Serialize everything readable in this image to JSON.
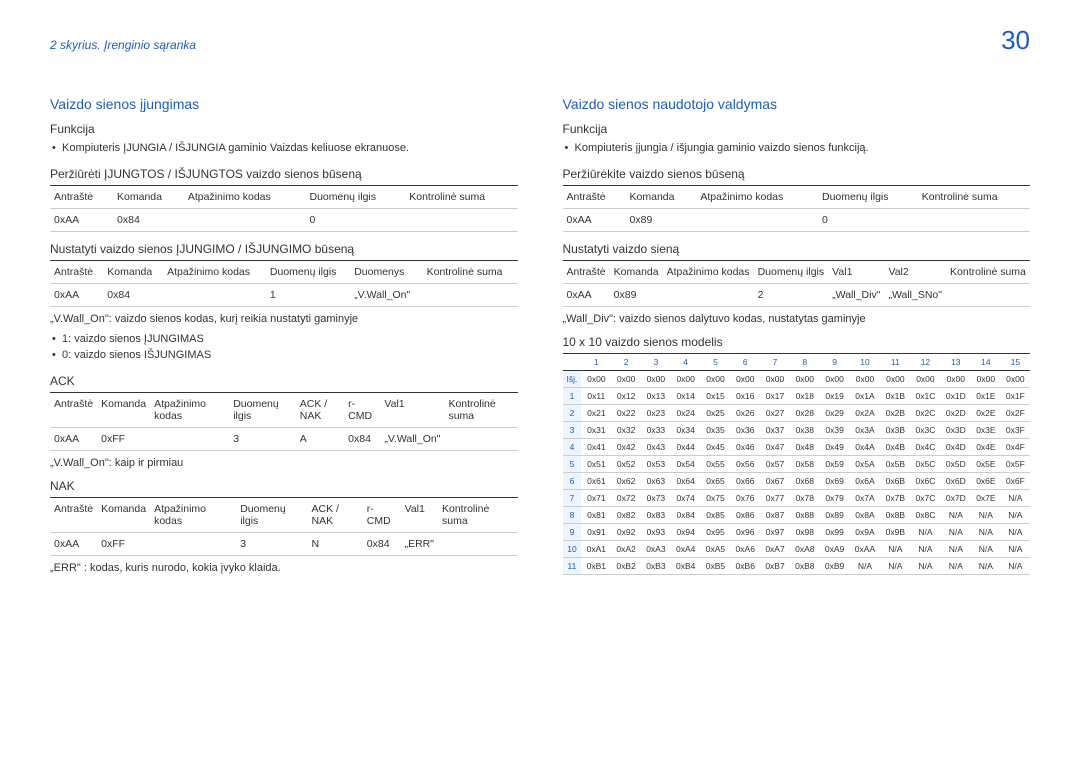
{
  "header": {
    "chapter": "2 skyrius. Įrenginio sąranka",
    "page": "30"
  },
  "left": {
    "title": "Vaizdo sienos įjungimas",
    "func_h": "Funkcija",
    "func_b_pre": "Kompiuteris ĮJUNGIA / IŠJUNGIA gaminio ",
    "func_b_hl": "Vaizdas keliuose ekranuose",
    "func_b_post": ".",
    "view_h": "Peržiūrėti ĮJUNGTOS / IŠJUNGTOS vaizdo sienos būseną",
    "view_th": [
      "Antraštė",
      "Komanda",
      "Atpažinimo kodas",
      "Duomenų ilgis",
      "Kontrolinė suma"
    ],
    "view_td": [
      "0xAA",
      "0x84",
      "",
      "0",
      ""
    ],
    "set_h": "Nustatyti vaizdo sienos ĮJUNGIMO / IŠJUNGIMO būseną",
    "set_th": [
      "Antraštė",
      "Komanda",
      "Atpažinimo kodas",
      "Duomenų ilgis",
      "Duomenys",
      "Kontrolinė suma"
    ],
    "set_td": [
      "0xAA",
      "0x84",
      "",
      "1",
      "„V.Wall_On\"",
      ""
    ],
    "note1": "„V.Wall_On\": vaizdo sienos kodas, kurį reikia nustatyti gaminyje",
    "bul1": "1: vaizdo sienos ĮJUNGIMAS",
    "bul2": "0: vaizdo sienos IŠJUNGIMAS",
    "ack_h": "ACK",
    "ack_th": [
      "Antraštė",
      "Komanda",
      "Atpažinimo kodas",
      "Duomenų ilgis",
      "ACK / NAK",
      "r-CMD",
      "Val1",
      "Kontrolinė suma"
    ],
    "ack_td": [
      "0xAA",
      "0xFF",
      "",
      "3",
      "A",
      "0x84",
      "„V.Wall_On\"",
      ""
    ],
    "note2": "„V.Wall_On\": kaip ir pirmiau",
    "nak_h": "NAK",
    "nak_th": [
      "Antraštė",
      "Komanda",
      "Atpažinimo kodas",
      "Duomenų ilgis",
      "ACK / NAK",
      "r-CMD",
      "Val1",
      "Kontrolinė suma"
    ],
    "nak_td": [
      "0xAA",
      "0xFF",
      "",
      "3",
      "N",
      "0x84",
      "„ERR\"",
      ""
    ],
    "note3": "„ERR\" : kodas, kuris nurodo, kokia įvyko klaida."
  },
  "right": {
    "title": "Vaizdo sienos naudotojo valdymas",
    "func_h": "Funkcija",
    "func_b": "Kompiuteris įjungia / išjungia gaminio vaizdo sienos funkciją.",
    "view_h": "Peržiūrėkite vaizdo sienos būseną",
    "view_th": [
      "Antraštė",
      "Komanda",
      "Atpažinimo kodas",
      "Duomenų ilgis",
      "Kontrolinė suma"
    ],
    "view_td": [
      "0xAA",
      "0x89",
      "",
      "0",
      ""
    ],
    "set_h": "Nustatyti vaizdo sieną",
    "set_th": [
      "Antraštė",
      "Komanda",
      "Atpažinimo kodas",
      "Duomenų ilgis",
      "Val1",
      "Val2",
      "Kontrolinė suma"
    ],
    "set_td": [
      "0xAA",
      "0x89",
      "",
      "2",
      "„Wall_Div\"",
      "„Wall_SNo\"",
      ""
    ],
    "note_div": "„Wall_Div\": vaizdo sienos dalytuvo kodas, nustatytas gaminyje",
    "matrix_h": "10 x 10 vaizdo sienos modelis"
  },
  "chart_data": {
    "type": "table",
    "title": "10 x 10 vaizdo sienos modelis",
    "col_headers": [
      "1",
      "2",
      "3",
      "4",
      "5",
      "6",
      "7",
      "8",
      "9",
      "10",
      "11",
      "12",
      "13",
      "14",
      "15"
    ],
    "row_headers": [
      "Išj.",
      "1",
      "2",
      "3",
      "4",
      "5",
      "6",
      "7",
      "8",
      "9",
      "10",
      "11"
    ],
    "rows": [
      [
        "0x00",
        "0x00",
        "0x00",
        "0x00",
        "0x00",
        "0x00",
        "0x00",
        "0x00",
        "0x00",
        "0x00",
        "0x00",
        "0x00",
        "0x00",
        "0x00",
        "0x00"
      ],
      [
        "0x11",
        "0x12",
        "0x13",
        "0x14",
        "0x15",
        "0x16",
        "0x17",
        "0x18",
        "0x19",
        "0x1A",
        "0x1B",
        "0x1C",
        "0x1D",
        "0x1E",
        "0x1F"
      ],
      [
        "0x21",
        "0x22",
        "0x23",
        "0x24",
        "0x25",
        "0x26",
        "0x27",
        "0x28",
        "0x29",
        "0x2A",
        "0x2B",
        "0x2C",
        "0x2D",
        "0x2E",
        "0x2F"
      ],
      [
        "0x31",
        "0x32",
        "0x33",
        "0x34",
        "0x35",
        "0x36",
        "0x37",
        "0x38",
        "0x39",
        "0x3A",
        "0x3B",
        "0x3C",
        "0x3D",
        "0x3E",
        "0x3F"
      ],
      [
        "0x41",
        "0x42",
        "0x43",
        "0x44",
        "0x45",
        "0x46",
        "0x47",
        "0x48",
        "0x49",
        "0x4A",
        "0x4B",
        "0x4C",
        "0x4D",
        "0x4E",
        "0x4F"
      ],
      [
        "0x51",
        "0x52",
        "0x53",
        "0x54",
        "0x55",
        "0x56",
        "0x57",
        "0x58",
        "0x59",
        "0x5A",
        "0x5B",
        "0x5C",
        "0x5D",
        "0x5E",
        "0x5F"
      ],
      [
        "0x61",
        "0x62",
        "0x63",
        "0x64",
        "0x65",
        "0x66",
        "0x67",
        "0x68",
        "0x69",
        "0x6A",
        "0x6B",
        "0x6C",
        "0x6D",
        "0x6E",
        "0x6F"
      ],
      [
        "0x71",
        "0x72",
        "0x73",
        "0x74",
        "0x75",
        "0x76",
        "0x77",
        "0x78",
        "0x79",
        "0x7A",
        "0x7B",
        "0x7C",
        "0x7D",
        "0x7E",
        "N/A"
      ],
      [
        "0x81",
        "0x82",
        "0x83",
        "0x84",
        "0x85",
        "0x86",
        "0x87",
        "0x88",
        "0x89",
        "0x8A",
        "0x8B",
        "0x8C",
        "N/A",
        "N/A",
        "N/A"
      ],
      [
        "0x91",
        "0x92",
        "0x93",
        "0x94",
        "0x95",
        "0x96",
        "0x97",
        "0x98",
        "0x99",
        "0x9A",
        "0x9B",
        "N/A",
        "N/A",
        "N/A",
        "N/A"
      ],
      [
        "0xA1",
        "0xA2",
        "0xA3",
        "0xA4",
        "0xA5",
        "0xA6",
        "0xA7",
        "0xA8",
        "0xA9",
        "0xAA",
        "N/A",
        "N/A",
        "N/A",
        "N/A",
        "N/A"
      ],
      [
        "0xB1",
        "0xB2",
        "0xB3",
        "0xB4",
        "0xB5",
        "0xB6",
        "0xB7",
        "0xB8",
        "0xB9",
        "N/A",
        "N/A",
        "N/A",
        "N/A",
        "N/A",
        "N/A"
      ]
    ]
  }
}
